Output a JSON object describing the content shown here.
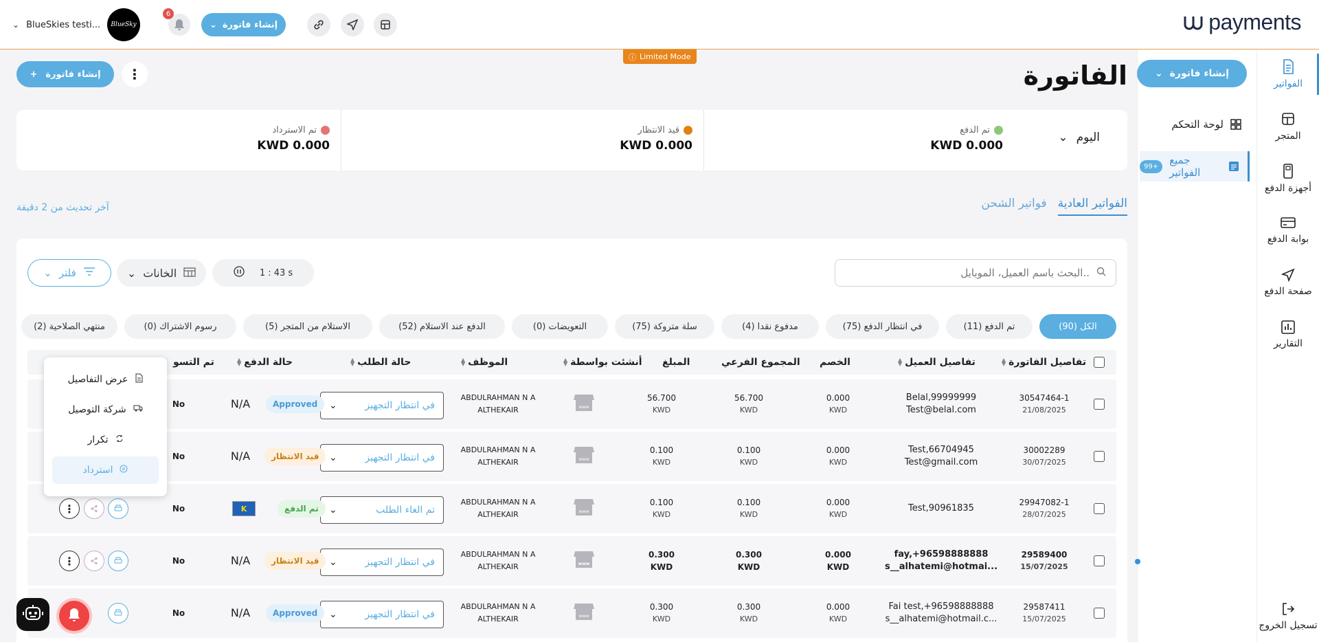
{
  "brand": {
    "logo_text": "payments"
  },
  "topbar": {
    "user_name": "BlueSkies testi...",
    "avatar_text": "BlueSky",
    "notification_count": "6",
    "create_invoice_label": "إنشاء فاتورة"
  },
  "nav": {
    "items": [
      {
        "label": "الفواتير",
        "icon": "invoice-icon",
        "active": true
      },
      {
        "label": "المتجر",
        "icon": "store-icon"
      },
      {
        "label": "أجهزة الدفع",
        "icon": "pos-device-icon"
      },
      {
        "label": "بوابة الدفع",
        "icon": "payment-gateway-icon"
      },
      {
        "label": "صفحة الدفع",
        "icon": "send-icon"
      },
      {
        "label": "التقارير",
        "icon": "reports-icon"
      }
    ],
    "logout": "تسجيل الخروج"
  },
  "subnav": {
    "create_label": "إنشاء فاتورة",
    "dashboard": "لوحة التحكم",
    "all_invoices": "جميع الفواتير",
    "all_invoices_badge": "99+"
  },
  "main": {
    "limited_mode": "Limited Mode",
    "title": "الفاتورة",
    "create_label": "إنشاء فاتورة",
    "period": "اليوم",
    "stats": [
      {
        "label": "تم الدفع",
        "value": "KWD 0.000",
        "color": "#8bc97a"
      },
      {
        "label": "قيد الانتظار",
        "value": "KWD 0.000",
        "color": "#e0820e"
      },
      {
        "label": "تم الاسترداد",
        "value": "KWD 0.000",
        "color": "#e57373"
      }
    ],
    "tabs": [
      "الفواتير العادية",
      "فواتير الشحن"
    ],
    "last_update": "آخر تحديث من 2 دقيقة",
    "search_placeholder": "البحث باسم العميل، الموبايل..",
    "timer": "1 : 43 s",
    "columns_label": "الخانات",
    "filter_label": "فلتر",
    "chips": [
      "الكل (90)",
      "تم الدفع (11)",
      "في انتظار الدفع (75)",
      "مدفوع نقدا (4)",
      "سلة متروكة (75)",
      "التعويضات (0)",
      "الدفع عند الاستلام (52)",
      "الاستلام من المتجر (5)",
      "رسوم الاشتراك (0)",
      "منتهي الصلاحية (2)"
    ],
    "headers": {
      "invoice": "تفاصيل الفاتورة",
      "customer": "تفاصيل العميل",
      "discount": "الخصم",
      "subtotal": "المجموع الفرعي",
      "amount": "المبلغ",
      "created_by": "أنشئت بواسطة",
      "employee": "الموظف",
      "order_status": "حالة الطلب",
      "payment_status": "حالة الدفع",
      "settled": "تم التسو"
    },
    "rows": [
      {
        "id": "30547464-1",
        "date": "21/08/2025",
        "customer_line1": "Belal,99999999",
        "customer_line2": "Test@belal.com",
        "discount": "0.000",
        "subtotal": "56.700",
        "amount": "56.700",
        "currency": "KWD",
        "employee_line1": "ABDULRAHMAN N A",
        "employee_line2": "ALTHEKAIR",
        "order_status": "في انتظار التجهيز",
        "pay_method": "N/A",
        "payment_status": "Approved",
        "settled": "No"
      },
      {
        "id": "30002289",
        "date": "30/07/2025",
        "customer_line1": "Test,66704945",
        "customer_line2": "Test@gmail.com",
        "discount": "0.000",
        "subtotal": "0.100",
        "amount": "0.100",
        "currency": "KWD",
        "employee_line1": "ABDULRAHMAN N A",
        "employee_line2": "ALTHEKAIR",
        "order_status": "في انتظار التجهيز",
        "pay_method": "N/A",
        "payment_status": "قيد الانتظار",
        "settled": "No"
      },
      {
        "id": "29947082-1",
        "date": "28/07/2025",
        "customer_line1": "Test,90961835",
        "customer_line2": "",
        "discount": "0.000",
        "subtotal": "0.100",
        "amount": "0.100",
        "currency": "KWD",
        "employee_line1": "ABDULRAHMAN N A",
        "employee_line2": "ALTHEKAIR",
        "order_status": "تم الغاء الطلب",
        "pay_method": "KNET",
        "payment_status": "تم الدفع",
        "settled": "No"
      },
      {
        "id": "29589400",
        "date": "15/07/2025",
        "customer_line1": "fay,+96598888888",
        "customer_line2": "s__alhatemi@hotmai...",
        "discount": "0.000",
        "subtotal": "0.300",
        "amount": "0.300",
        "currency": "KWD",
        "employee_line1": "ABDULRAHMAN N A",
        "employee_line2": "ALTHEKAIR",
        "order_status": "في انتظار التجهيز",
        "pay_method": "N/A",
        "payment_status": "قيد الانتظار",
        "settled": "No"
      },
      {
        "id": "29587411",
        "date": "15/07/2025",
        "customer_line1": "Fai test,+96598888888",
        "customer_line2": "s__alhatemi@hotmail.c...",
        "discount": "0.000",
        "subtotal": "0.300",
        "amount": "0.300",
        "currency": "KWD",
        "employee_line1": "ABDULRAHMAN N A",
        "employee_line2": "ALTHEKAIR",
        "order_status": "في انتظار التجهيز",
        "pay_method": "N/A",
        "payment_status": "Approved",
        "settled": "No"
      }
    ],
    "context_menu": [
      "عرض التفاصيل",
      "شركة التوصيل",
      "تكرار",
      "استرداد"
    ]
  }
}
